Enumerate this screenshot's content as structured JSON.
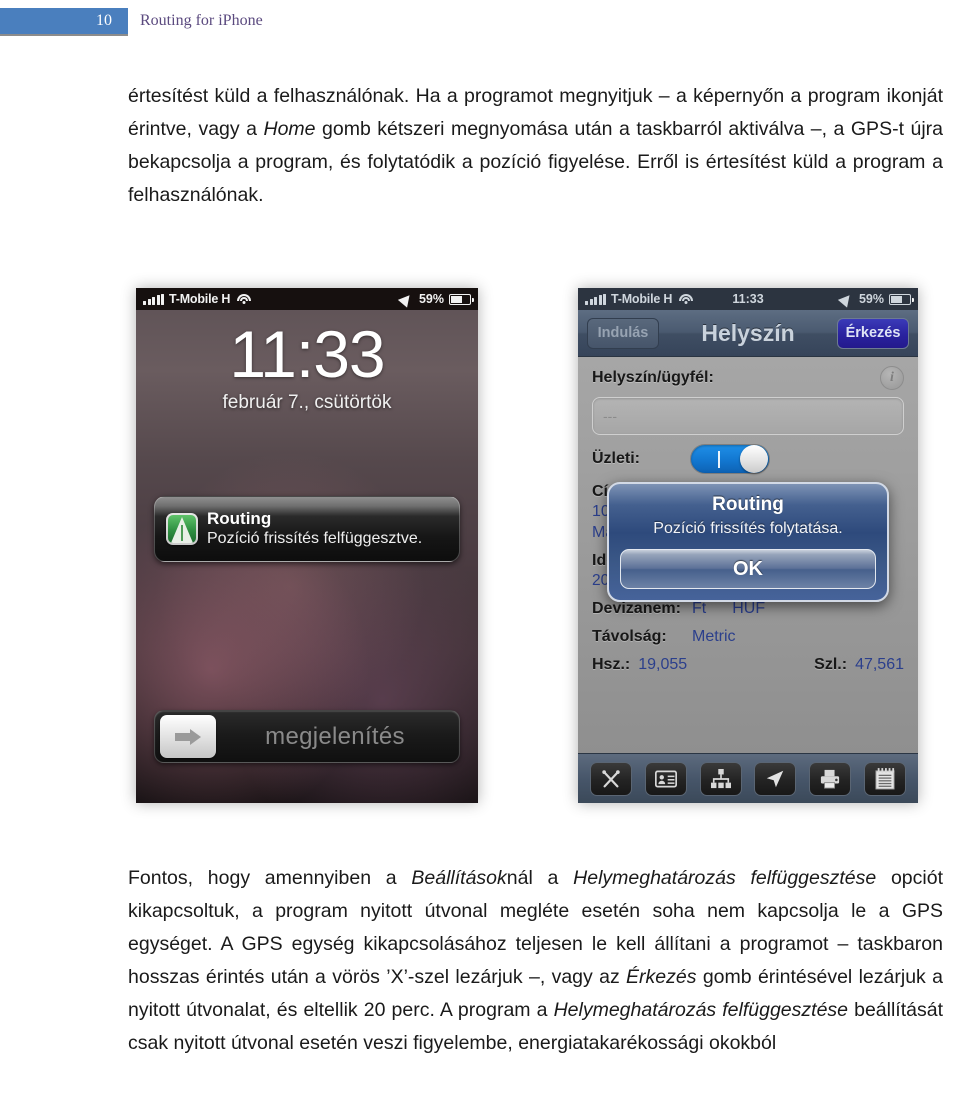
{
  "header": {
    "page_number": "10",
    "title": "Routing for iPhone",
    "bar_color": "#4a7fbe",
    "title_color": "#5b4a7f"
  },
  "paragraphs": {
    "p1": {
      "seg1": "értesítést küld a felhasználónak. Ha a programot megnyitjuk – a képernyőn a program ikonját érintve, vagy a ",
      "em1": "Home",
      "seg2": " gomb kétszeri megnyomása után a taskbarról aktiválva –, a GPS-t újra bekapcsolja a program, és folytatódik a pozíció figyelése. Erről is értesítést küld a program a felhasználónak."
    },
    "p2": {
      "seg1": "Fontos, hogy amennyiben a ",
      "em1": "Beállítások",
      "seg2": "nál a ",
      "em2": "Helymeghatározás felfüggesztése",
      "seg3": " opciót kikapcsoltuk, a program nyitott útvonal megléte esetén soha nem kapcsolja le a GPS egységet. A GPS egység kikapcsolásához teljesen le kell állítani a programot – taskbaron hosszas érintés után a vörös ’X’-szel lezárjuk –, vagy az ",
      "em3": "Érkezés",
      "seg4": " gomb érintésével lezárjuk a nyitott útvonalat, és eltellik 20 perc.  A program a ",
      "em4": "Helymeghatározás felfüggesztése",
      "seg5": " beállítását csak nyitott útvonal esetén veszi figyelembe, energiatakarékossági okokból"
    }
  },
  "phone_left": {
    "status_bar": {
      "carrier": "T-Mobile H",
      "signal_icon": "signal-bars-icon",
      "wifi_icon": "wifi-icon",
      "location_icon": "location-arrow-icon",
      "battery_percent": "59%",
      "battery_icon": "battery-icon"
    },
    "lock_time": "11:33",
    "lock_date": "február 7., csütörtök",
    "notification": {
      "app_icon": "routing-app-icon",
      "title": "Routing",
      "message": "Pozíció frissítés felfüggesztve."
    },
    "slider": {
      "arrow_icon": "arrow-right-icon",
      "label": "megjelenítés"
    }
  },
  "phone_right": {
    "status_bar": {
      "carrier": "T-Mobile H",
      "signal_icon": "signal-bars-icon",
      "wifi_icon": "wifi-icon",
      "clock": "11:33",
      "location_icon": "location-arrow-icon",
      "battery_percent": "59%",
      "battery_icon": "battery-icon"
    },
    "nav": {
      "back_label": "Indulás",
      "title": "Helyszín",
      "forward_label": "Érkezés",
      "forward_color": "#2a23a0"
    },
    "form": {
      "site_label": "Helyszín/ügyfél:",
      "info_icon": "info-icon",
      "site_value": "---",
      "business_label": "Üzleti:",
      "business_toggle": "on",
      "address_label": "Cím:",
      "address_value": "1031 Budapest, Graphisoft park, Magyarország",
      "time_label": "Időpont:",
      "time_value": "2013. február 7. 11:13:25 CET",
      "currency_label": "Devizanem:",
      "currency_symbol": "Ft",
      "currency_code": "HUF",
      "distance_label": "Távolság:",
      "distance_value": "Metric",
      "start_odo_label": "Hsz.:",
      "start_odo_value": "19,055",
      "end_odo_label": "Szl.:",
      "end_odo_value": "47,561"
    },
    "alert": {
      "title": "Routing",
      "message": "Pozíció frissítés folytatása.",
      "ok_label": "OK"
    },
    "toolbar_icons": [
      "tools-icon",
      "contact-card-icon",
      "hierarchy-icon",
      "navigation-arrow-icon",
      "printer-icon",
      "notepad-icon"
    ]
  }
}
